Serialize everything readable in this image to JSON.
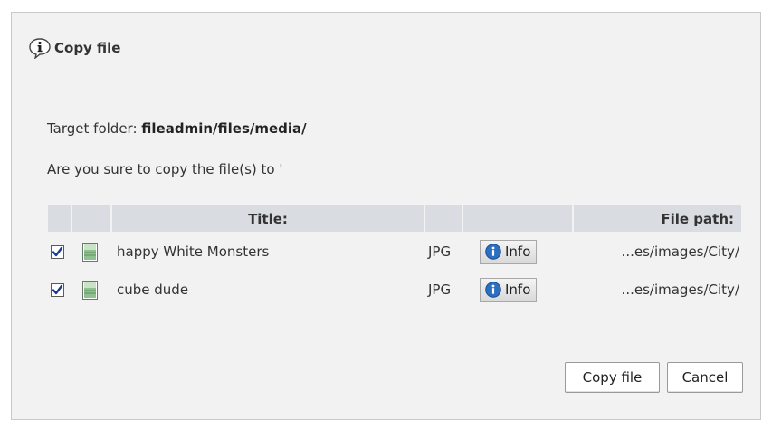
{
  "dialog": {
    "title": "Copy file",
    "target_label": "Target folder:",
    "target_path": "fileadmin/files/media/",
    "question": "Are you sure to copy the file(s) to '"
  },
  "table": {
    "headers": [
      "",
      "",
      "Title:",
      "",
      "",
      "File path:"
    ],
    "rows": [
      {
        "checked": true,
        "title": "happy White Monsters",
        "type": "JPG",
        "info_label": "Info",
        "path": "...es/images/City/"
      },
      {
        "checked": true,
        "title": "cube dude",
        "type": "JPG",
        "info_label": "Info",
        "path": "...es/images/City/"
      }
    ]
  },
  "buttons": {
    "copy_label": "Copy file",
    "cancel_label": "Cancel"
  },
  "colors": {
    "dialog_bg": "#f2f2f2",
    "header_bg": "#d9dde2",
    "info_icon_blue": "#2a6fc0"
  }
}
